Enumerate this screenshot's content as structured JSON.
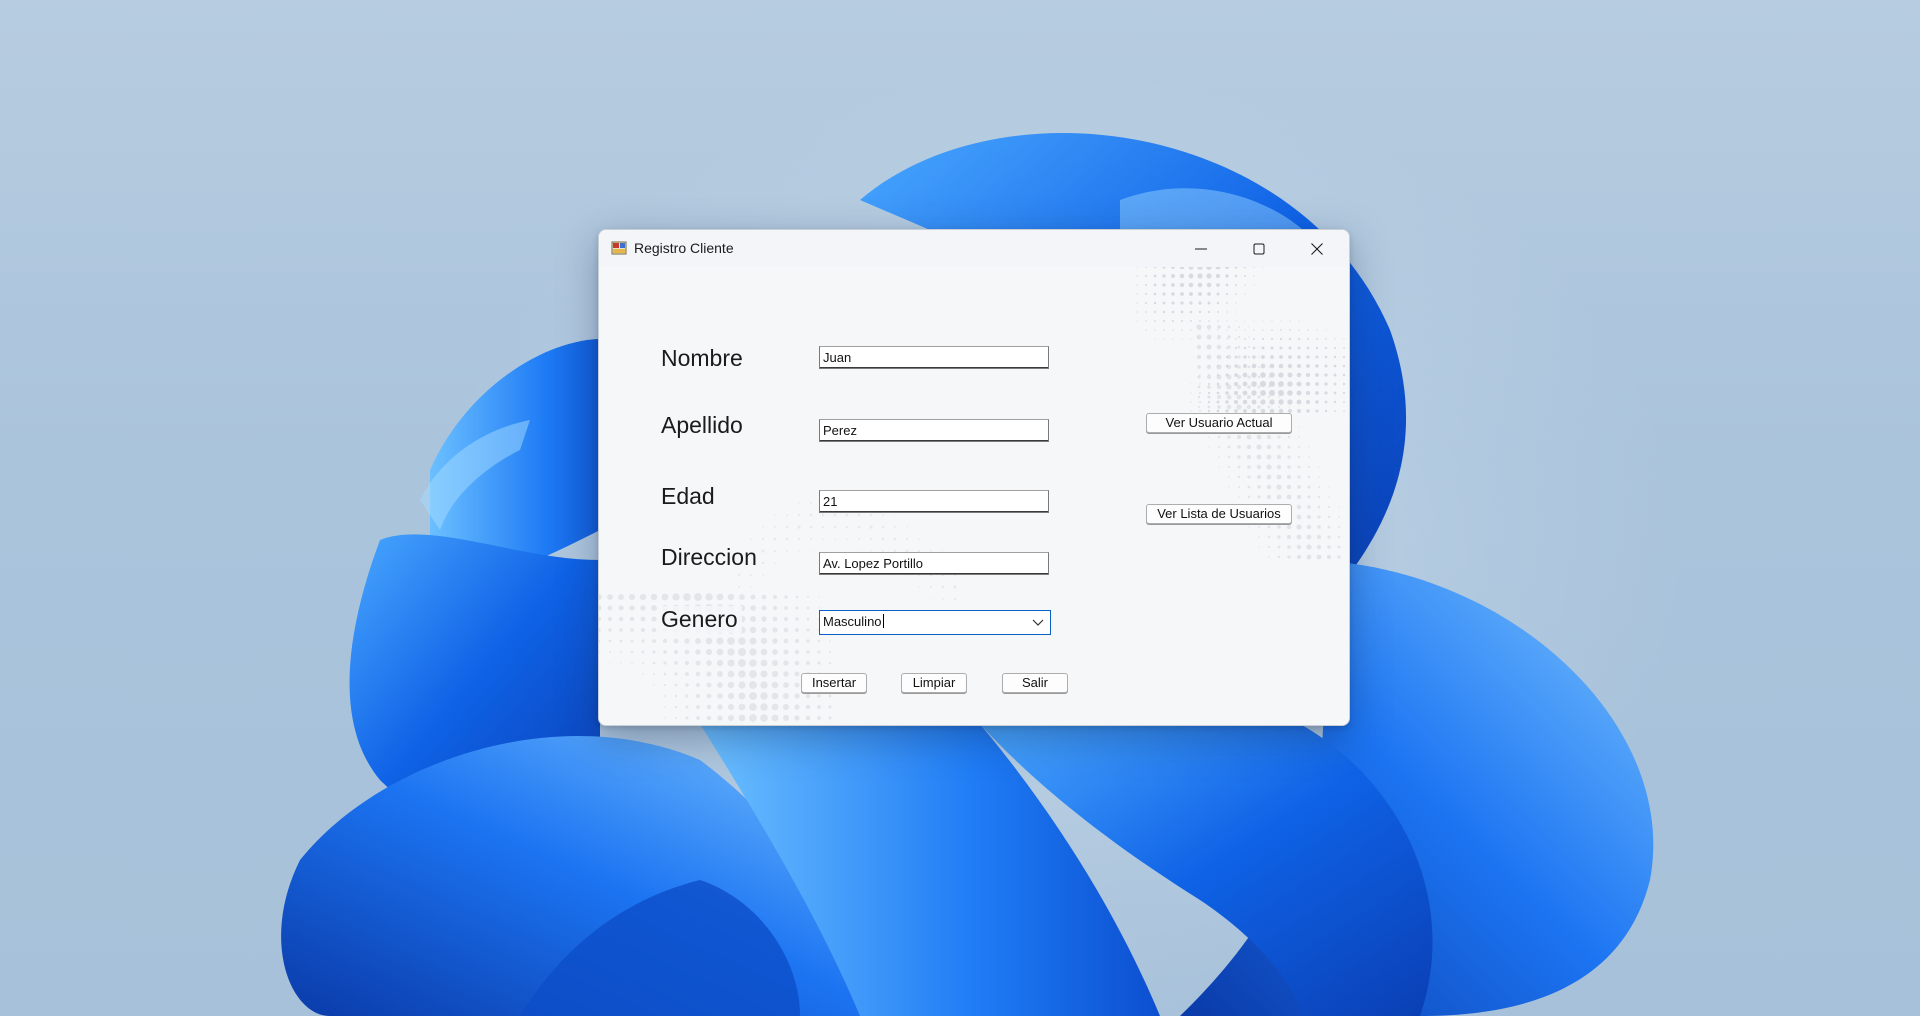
{
  "window": {
    "title": "Registro Cliente",
    "app_icon": "app-form-icon",
    "caption_buttons": [
      "minimize-icon",
      "maximize-icon",
      "close-icon"
    ]
  },
  "form": {
    "nombre": {
      "label": "Nombre",
      "value": "Juan"
    },
    "apellido": {
      "label": "Apellido",
      "value": "Perez"
    },
    "edad": {
      "label": "Edad",
      "value": "21"
    },
    "direccion": {
      "label": "Direccion",
      "value": "Av. Lopez Portillo"
    },
    "genero": {
      "label": "Genero",
      "value": "Masculino"
    }
  },
  "buttons": {
    "ver_usuario_actual": "Ver Usuario Actual",
    "ver_lista_usuarios": "Ver Lista de Usuarios",
    "insertar": "Insertar",
    "limpiar": "Limpiar",
    "salir": "Salir"
  },
  "colors": {
    "wallpaper_bg": "#a9c3dc",
    "bloom_blue": "#1a6ff0",
    "combo_focus": "#0a62c8",
    "form_bg": "#f6f7f9"
  }
}
